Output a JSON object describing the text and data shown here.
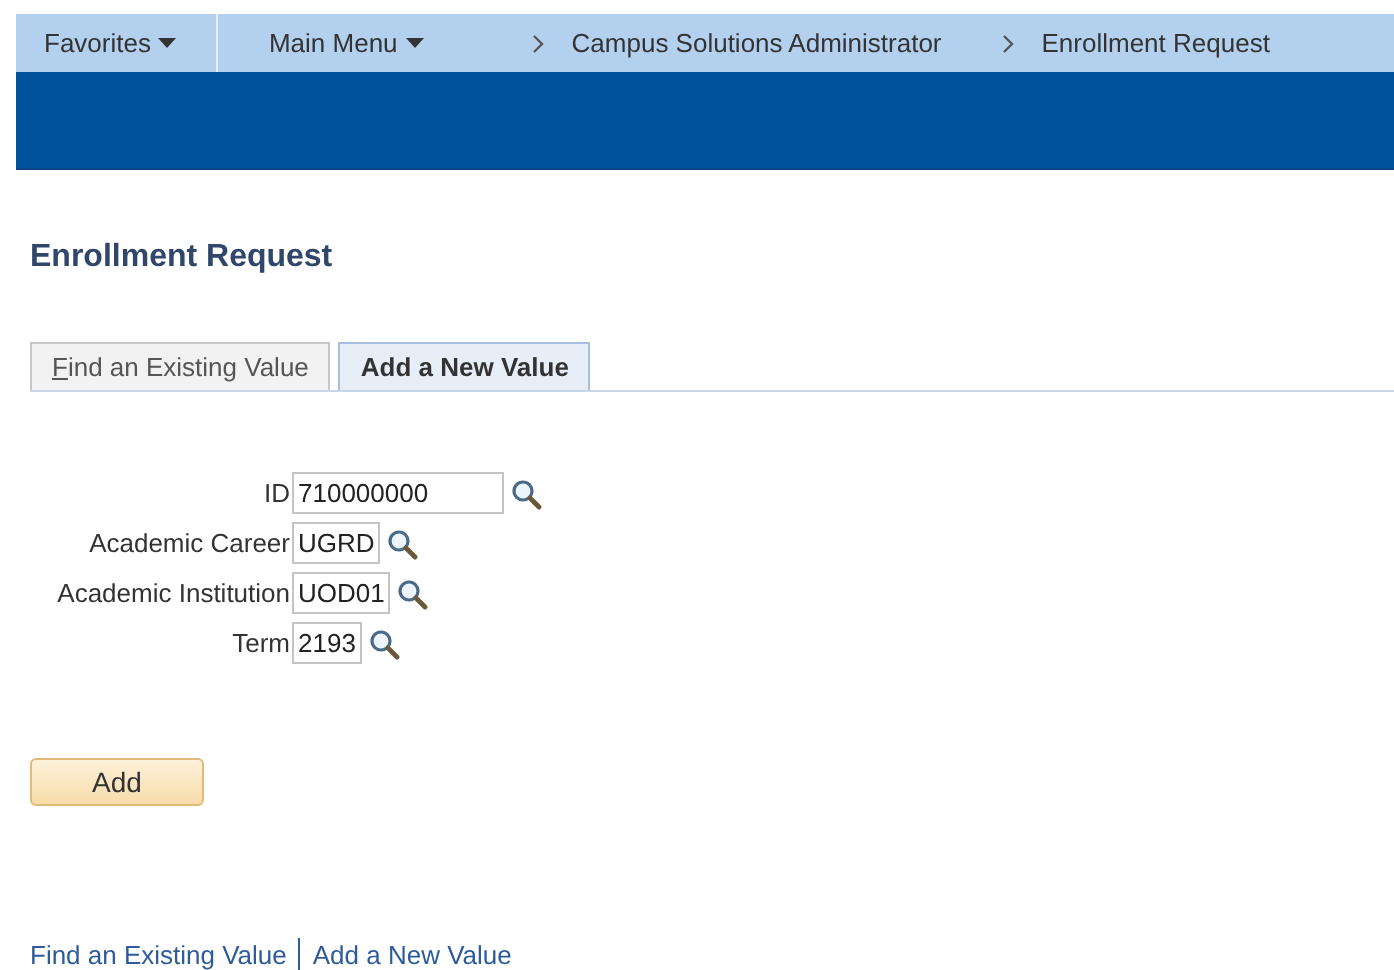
{
  "nav": {
    "favorites": "Favorites",
    "main_menu": "Main Menu",
    "breadcrumbs": [
      "Campus Solutions Administrator",
      "Enrollment Request"
    ]
  },
  "page_title": "Enrollment Request",
  "tabs": [
    {
      "label": "Find an Existing Value",
      "selected": false
    },
    {
      "label": "Add a New Value",
      "selected": true
    }
  ],
  "fields": [
    {
      "label": "ID",
      "value": "710000000",
      "kind": "wide"
    },
    {
      "label": "Academic Career",
      "value": "UGRD",
      "kind": "narrow"
    },
    {
      "label": "Academic Institution",
      "value": "UOD01",
      "kind": "narrow"
    },
    {
      "label": "Term",
      "value": "2193",
      "kind": "narrow"
    }
  ],
  "add_button": "Add",
  "footer_links": [
    "Find an Existing Value",
    "Add a New Value"
  ]
}
